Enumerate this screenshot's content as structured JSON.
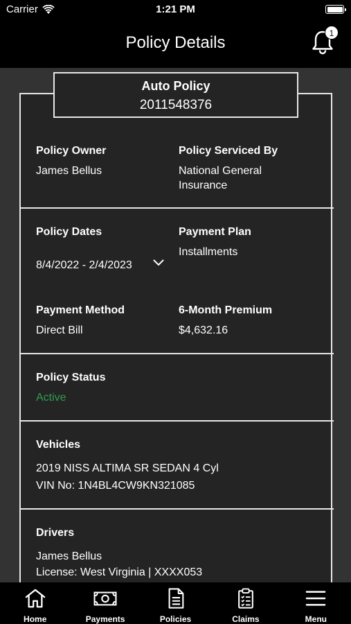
{
  "status_bar": {
    "carrier": "Carrier",
    "time": "1:21 PM"
  },
  "nav": {
    "title": "Policy Details",
    "notification_count": "1"
  },
  "policy_header": {
    "title": "Auto Policy",
    "number": "2011548376"
  },
  "fields": {
    "owner_label": "Policy Owner",
    "owner_value": "James Bellus",
    "serviced_label": "Policy Serviced By",
    "serviced_value_line1": "National General",
    "serviced_value_line2": "Insurance",
    "dates_label": "Policy Dates",
    "dates_value": "8/4/2022 - 2/4/2023",
    "plan_label": "Payment Plan",
    "plan_value": "Installments",
    "method_label": "Payment Method",
    "method_value": "Direct Bill",
    "premium_label": "6-Month Premium",
    "premium_value": "$4,632.16",
    "status_label": "Policy Status",
    "status_value": "Active",
    "status_color": "#2e9e4f",
    "vehicles_label": "Vehicles",
    "vehicle_name": "2019 NISS ALTIMA SR SEDAN 4 Cyl",
    "vehicle_vin": "VIN No: 1N4BL4CW9KN321085",
    "drivers_label": "Drivers",
    "driver_name": "James Bellus",
    "driver_license": "License: West Virginia | XXXX053"
  },
  "tabs": [
    {
      "label": "Home",
      "icon": "home-icon"
    },
    {
      "label": "Payments",
      "icon": "payments-icon"
    },
    {
      "label": "Policies",
      "icon": "policies-icon"
    },
    {
      "label": "Claims",
      "icon": "claims-icon"
    },
    {
      "label": "Menu",
      "icon": "menu-icon"
    }
  ]
}
